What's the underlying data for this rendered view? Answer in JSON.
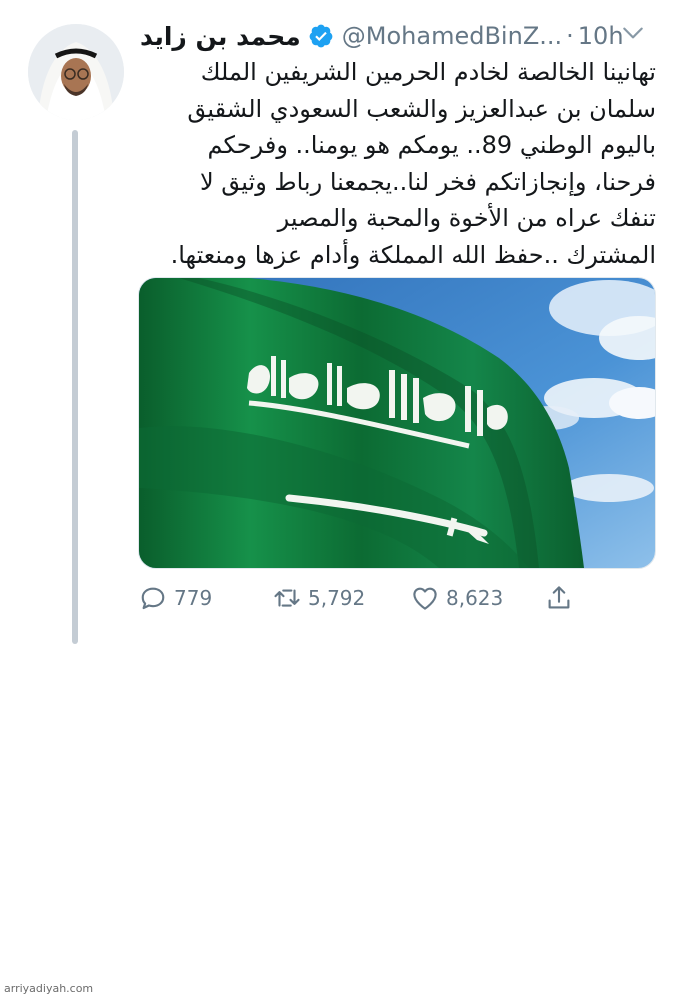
{
  "tweet": {
    "display_name": "محمد بن زايد",
    "handle": "@MohamedBinZ...",
    "separator": "·",
    "time": "10h",
    "text_lines": [
      "تهانينا الخالصة لخادم الحرمين الشريفين الملك",
      "سلمان بن عبدالعزيز والشعب السعودي الشقيق",
      "باليوم الوطني 89.. يومكم هو يومنا.. وفرحكم",
      "فرحنا، وإنجازاتكم فخر لنا..يجمعنا رباط وثيق لا",
      "تنفك عراه من الأخوة والمحبة والمصير",
      "المشترك ..حفظ الله المملكة وأدام عزها ومنعتها."
    ]
  },
  "actions": {
    "reply_count": "779",
    "retweet_count": "5,792",
    "like_count": "8,623"
  },
  "icons": {
    "verified": "verified-badge-icon",
    "caret": "chevron-down-icon",
    "reply": "reply-icon",
    "retweet": "retweet-icon",
    "like": "heart-icon",
    "share": "share-icon"
  },
  "colors": {
    "verified_blue": "#1da1f2",
    "muted_gray": "#657786",
    "thread_line": "#c4ccd4",
    "flag_green": "#0f7a3a",
    "sky_blue": "#3f86cf"
  },
  "watermark": "arriyadiyah.com"
}
